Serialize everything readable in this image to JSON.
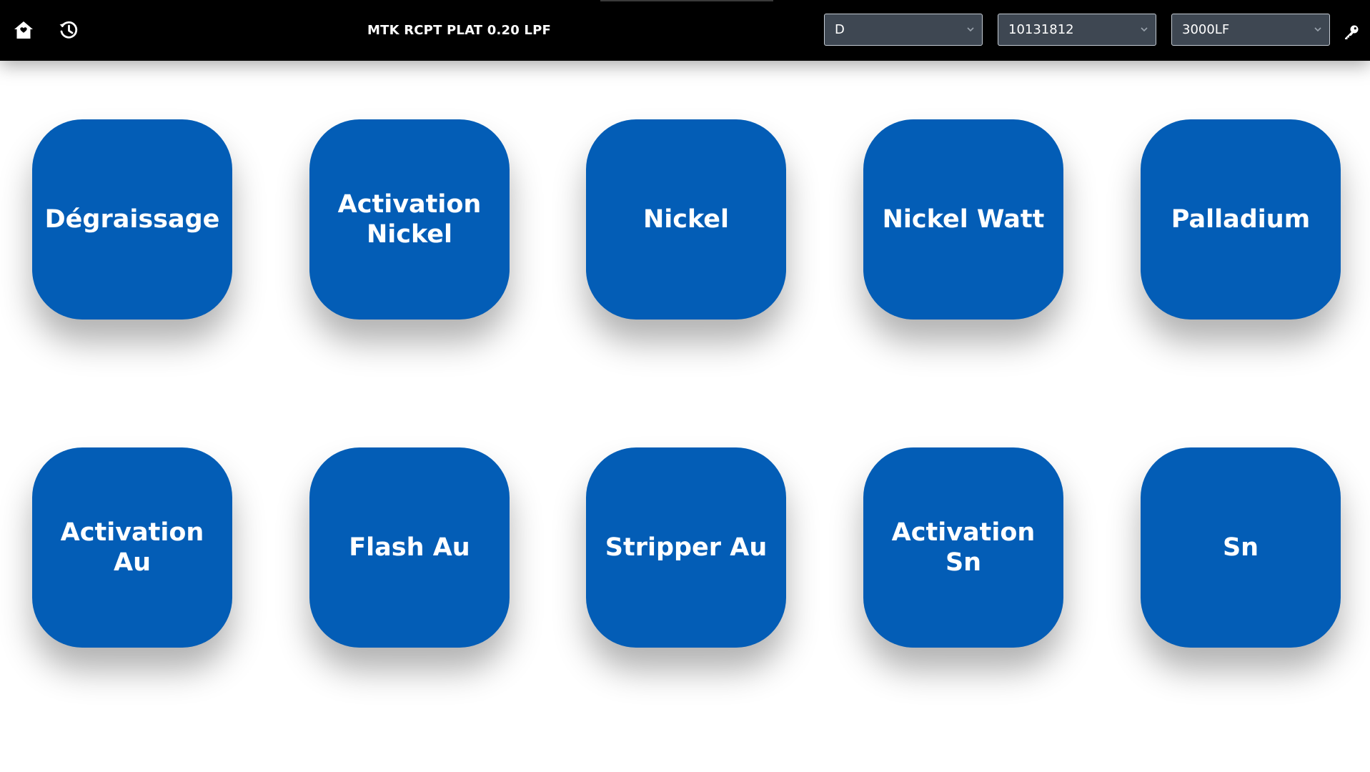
{
  "header": {
    "title": "MTK RCPT PLAT 0.20 LPF",
    "home_icon": "home-icon",
    "history_icon": "history-icon",
    "key_icon": "key-icon",
    "selects": [
      {
        "value": "D"
      },
      {
        "value": "10131812"
      },
      {
        "value": "3000LF"
      }
    ]
  },
  "tiles": [
    {
      "label": "Dégraissage"
    },
    {
      "label": "Activation Nickel"
    },
    {
      "label": "Nickel"
    },
    {
      "label": "Nickel Watt"
    },
    {
      "label": "Palladium"
    },
    {
      "label": "Activation Au"
    },
    {
      "label": "Flash Au"
    },
    {
      "label": "Stripper Au"
    },
    {
      "label": "Activation Sn"
    },
    {
      "label": "Sn"
    }
  ],
  "colors": {
    "header_bg": "#000000",
    "tile_bg": "#035db6",
    "select_bg": "#3e4752",
    "page_bg": "#ffffff"
  }
}
